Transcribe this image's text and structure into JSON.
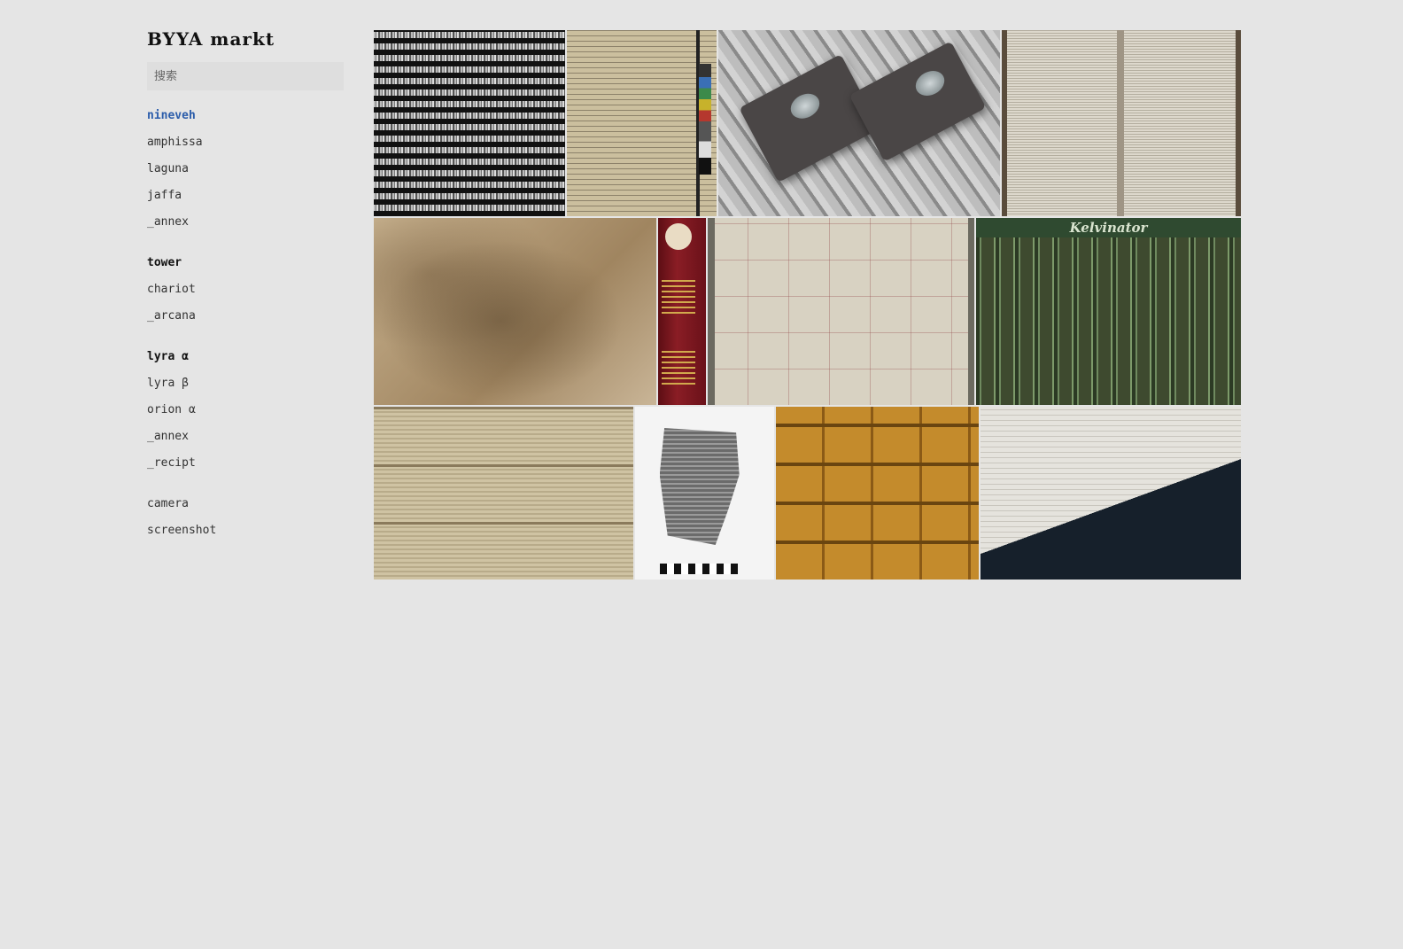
{
  "app": {
    "logo": "BYYA markt"
  },
  "search": {
    "placeholder": "搜索"
  },
  "nav": {
    "groups": [
      {
        "items": [
          {
            "label": "nineveh",
            "state": "active"
          },
          {
            "label": "amphissa"
          },
          {
            "label": "laguna"
          },
          {
            "label": "jaffa"
          },
          {
            "label": "_annex"
          }
        ]
      },
      {
        "items": [
          {
            "label": "tower",
            "state": "heading"
          },
          {
            "label": "chariot"
          },
          {
            "label": "_arcana"
          }
        ]
      },
      {
        "items": [
          {
            "label": "lyra α",
            "state": "heading"
          },
          {
            "label": "lyra β"
          },
          {
            "label": "orion α"
          },
          {
            "label": "_annex"
          },
          {
            "label": "_recipt"
          }
        ]
      },
      {
        "items": [
          {
            "label": "camera"
          },
          {
            "label": "screenshot"
          }
        ]
      }
    ]
  },
  "gallery": {
    "tiles": {
      "kelvinator_header": "Kelvinator"
    }
  },
  "colors": {
    "background": "#e5e5e5",
    "active_link": "#2a5caa",
    "search_bg": "#dedede"
  }
}
